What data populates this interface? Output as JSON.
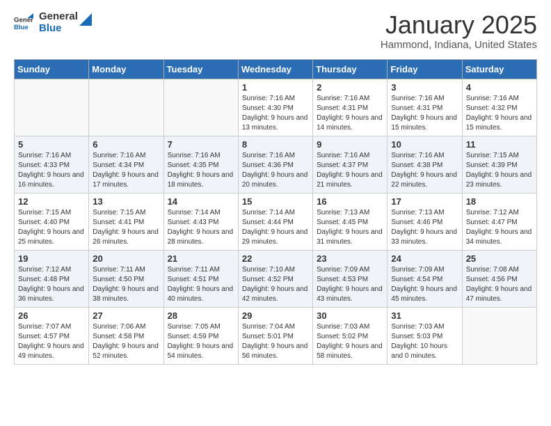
{
  "header": {
    "logo": {
      "general": "General",
      "blue": "Blue"
    },
    "title": "January 2025",
    "location": "Hammond, Indiana, United States"
  },
  "days_of_week": [
    "Sunday",
    "Monday",
    "Tuesday",
    "Wednesday",
    "Thursday",
    "Friday",
    "Saturday"
  ],
  "weeks": [
    [
      {
        "day": "",
        "sunrise": "",
        "sunset": "",
        "daylight": ""
      },
      {
        "day": "",
        "sunrise": "",
        "sunset": "",
        "daylight": ""
      },
      {
        "day": "",
        "sunrise": "",
        "sunset": "",
        "daylight": ""
      },
      {
        "day": "1",
        "sunrise": "Sunrise: 7:16 AM",
        "sunset": "Sunset: 4:30 PM",
        "daylight": "Daylight: 9 hours and 13 minutes."
      },
      {
        "day": "2",
        "sunrise": "Sunrise: 7:16 AM",
        "sunset": "Sunset: 4:31 PM",
        "daylight": "Daylight: 9 hours and 14 minutes."
      },
      {
        "day": "3",
        "sunrise": "Sunrise: 7:16 AM",
        "sunset": "Sunset: 4:31 PM",
        "daylight": "Daylight: 9 hours and 15 minutes."
      },
      {
        "day": "4",
        "sunrise": "Sunrise: 7:16 AM",
        "sunset": "Sunset: 4:32 PM",
        "daylight": "Daylight: 9 hours and 15 minutes."
      }
    ],
    [
      {
        "day": "5",
        "sunrise": "Sunrise: 7:16 AM",
        "sunset": "Sunset: 4:33 PM",
        "daylight": "Daylight: 9 hours and 16 minutes."
      },
      {
        "day": "6",
        "sunrise": "Sunrise: 7:16 AM",
        "sunset": "Sunset: 4:34 PM",
        "daylight": "Daylight: 9 hours and 17 minutes."
      },
      {
        "day": "7",
        "sunrise": "Sunrise: 7:16 AM",
        "sunset": "Sunset: 4:35 PM",
        "daylight": "Daylight: 9 hours and 18 minutes."
      },
      {
        "day": "8",
        "sunrise": "Sunrise: 7:16 AM",
        "sunset": "Sunset: 4:36 PM",
        "daylight": "Daylight: 9 hours and 20 minutes."
      },
      {
        "day": "9",
        "sunrise": "Sunrise: 7:16 AM",
        "sunset": "Sunset: 4:37 PM",
        "daylight": "Daylight: 9 hours and 21 minutes."
      },
      {
        "day": "10",
        "sunrise": "Sunrise: 7:16 AM",
        "sunset": "Sunset: 4:38 PM",
        "daylight": "Daylight: 9 hours and 22 minutes."
      },
      {
        "day": "11",
        "sunrise": "Sunrise: 7:15 AM",
        "sunset": "Sunset: 4:39 PM",
        "daylight": "Daylight: 9 hours and 23 minutes."
      }
    ],
    [
      {
        "day": "12",
        "sunrise": "Sunrise: 7:15 AM",
        "sunset": "Sunset: 4:40 PM",
        "daylight": "Daylight: 9 hours and 25 minutes."
      },
      {
        "day": "13",
        "sunrise": "Sunrise: 7:15 AM",
        "sunset": "Sunset: 4:41 PM",
        "daylight": "Daylight: 9 hours and 26 minutes."
      },
      {
        "day": "14",
        "sunrise": "Sunrise: 7:14 AM",
        "sunset": "Sunset: 4:43 PM",
        "daylight": "Daylight: 9 hours and 28 minutes."
      },
      {
        "day": "15",
        "sunrise": "Sunrise: 7:14 AM",
        "sunset": "Sunset: 4:44 PM",
        "daylight": "Daylight: 9 hours and 29 minutes."
      },
      {
        "day": "16",
        "sunrise": "Sunrise: 7:13 AM",
        "sunset": "Sunset: 4:45 PM",
        "daylight": "Daylight: 9 hours and 31 minutes."
      },
      {
        "day": "17",
        "sunrise": "Sunrise: 7:13 AM",
        "sunset": "Sunset: 4:46 PM",
        "daylight": "Daylight: 9 hours and 33 minutes."
      },
      {
        "day": "18",
        "sunrise": "Sunrise: 7:12 AM",
        "sunset": "Sunset: 4:47 PM",
        "daylight": "Daylight: 9 hours and 34 minutes."
      }
    ],
    [
      {
        "day": "19",
        "sunrise": "Sunrise: 7:12 AM",
        "sunset": "Sunset: 4:48 PM",
        "daylight": "Daylight: 9 hours and 36 minutes."
      },
      {
        "day": "20",
        "sunrise": "Sunrise: 7:11 AM",
        "sunset": "Sunset: 4:50 PM",
        "daylight": "Daylight: 9 hours and 38 minutes."
      },
      {
        "day": "21",
        "sunrise": "Sunrise: 7:11 AM",
        "sunset": "Sunset: 4:51 PM",
        "daylight": "Daylight: 9 hours and 40 minutes."
      },
      {
        "day": "22",
        "sunrise": "Sunrise: 7:10 AM",
        "sunset": "Sunset: 4:52 PM",
        "daylight": "Daylight: 9 hours and 42 minutes."
      },
      {
        "day": "23",
        "sunrise": "Sunrise: 7:09 AM",
        "sunset": "Sunset: 4:53 PM",
        "daylight": "Daylight: 9 hours and 43 minutes."
      },
      {
        "day": "24",
        "sunrise": "Sunrise: 7:09 AM",
        "sunset": "Sunset: 4:54 PM",
        "daylight": "Daylight: 9 hours and 45 minutes."
      },
      {
        "day": "25",
        "sunrise": "Sunrise: 7:08 AM",
        "sunset": "Sunset: 4:56 PM",
        "daylight": "Daylight: 9 hours and 47 minutes."
      }
    ],
    [
      {
        "day": "26",
        "sunrise": "Sunrise: 7:07 AM",
        "sunset": "Sunset: 4:57 PM",
        "daylight": "Daylight: 9 hours and 49 minutes."
      },
      {
        "day": "27",
        "sunrise": "Sunrise: 7:06 AM",
        "sunset": "Sunset: 4:58 PM",
        "daylight": "Daylight: 9 hours and 52 minutes."
      },
      {
        "day": "28",
        "sunrise": "Sunrise: 7:05 AM",
        "sunset": "Sunset: 4:59 PM",
        "daylight": "Daylight: 9 hours and 54 minutes."
      },
      {
        "day": "29",
        "sunrise": "Sunrise: 7:04 AM",
        "sunset": "Sunset: 5:01 PM",
        "daylight": "Daylight: 9 hours and 56 minutes."
      },
      {
        "day": "30",
        "sunrise": "Sunrise: 7:03 AM",
        "sunset": "Sunset: 5:02 PM",
        "daylight": "Daylight: 9 hours and 58 minutes."
      },
      {
        "day": "31",
        "sunrise": "Sunrise: 7:03 AM",
        "sunset": "Sunset: 5:03 PM",
        "daylight": "Daylight: 10 hours and 0 minutes."
      },
      {
        "day": "",
        "sunrise": "",
        "sunset": "",
        "daylight": ""
      }
    ]
  ]
}
